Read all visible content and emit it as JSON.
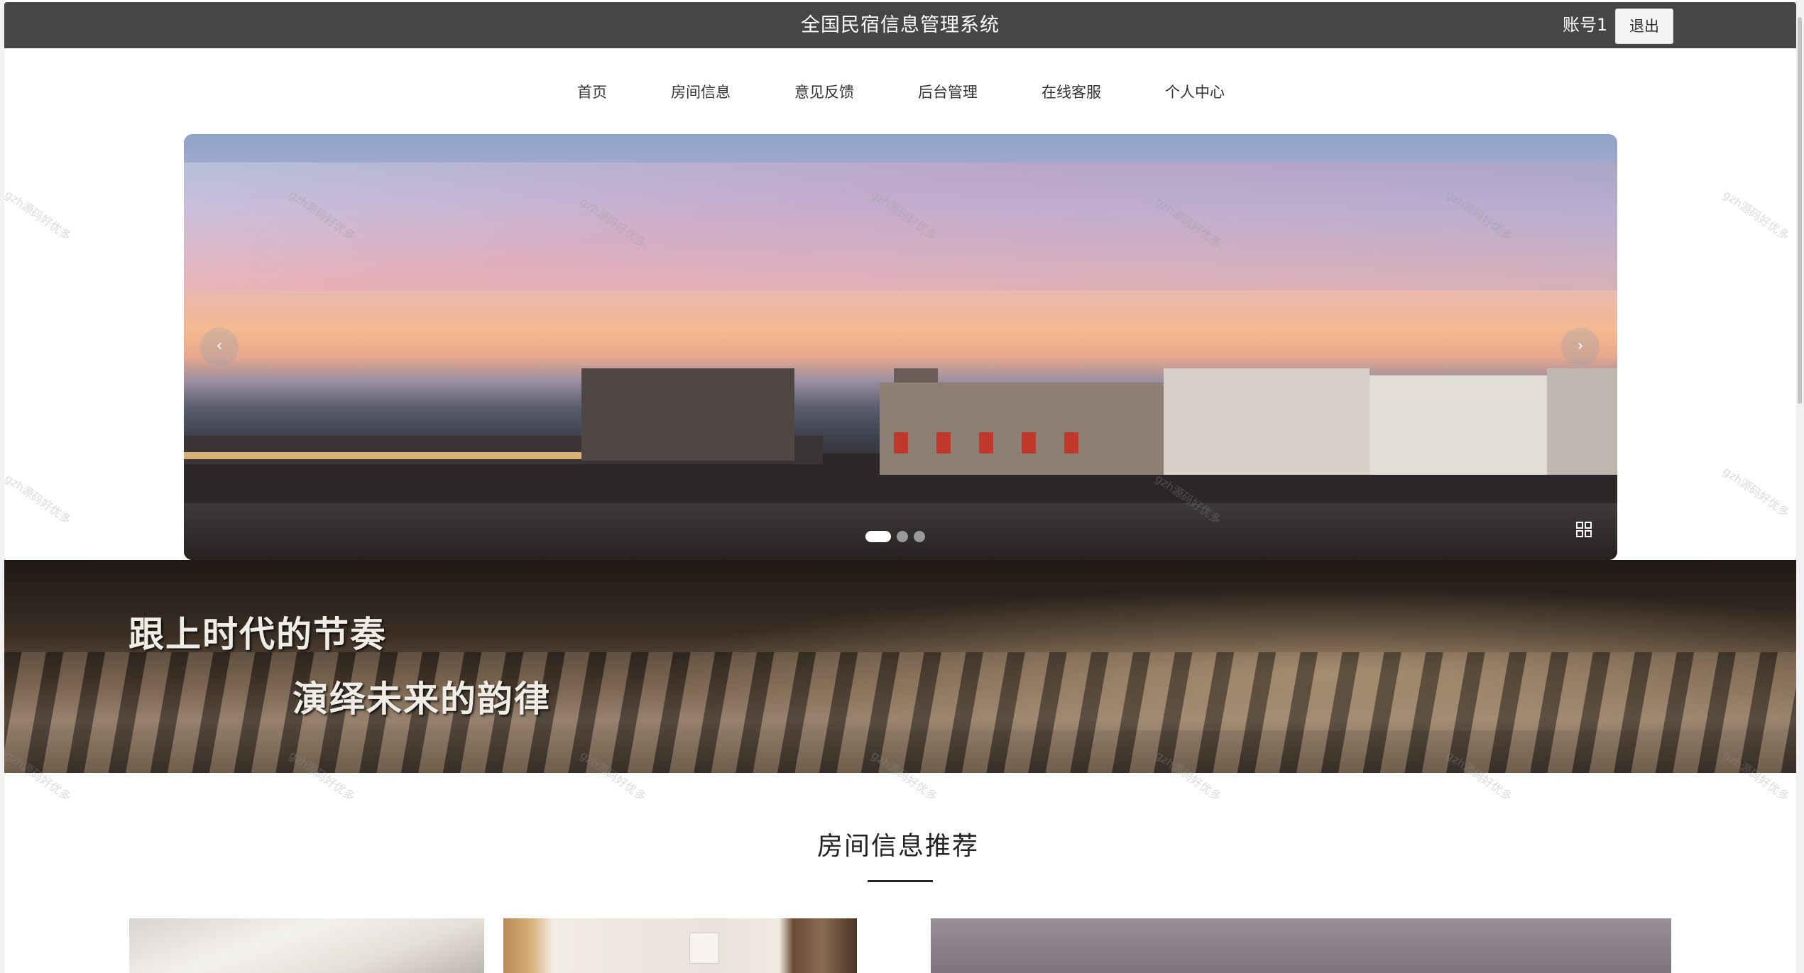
{
  "header": {
    "title": "全国民宿信息管理系统",
    "account": "账号1",
    "logout_label": "退出"
  },
  "nav": {
    "items": [
      {
        "label": "首页"
      },
      {
        "label": "房间信息"
      },
      {
        "label": "意见反馈"
      },
      {
        "label": "后台管理"
      },
      {
        "label": "在线客服"
      },
      {
        "label": "个人中心"
      }
    ],
    "active_index": 0
  },
  "carousel": {
    "prev_icon": "chevron-left-icon",
    "next_icon": "chevron-right-icon",
    "prev_glyph": "‹",
    "next_glyph": "›",
    "slide_count": 3,
    "active_slide": 0
  },
  "banner": {
    "line1": "跟上时代的节奏",
    "line2": "演绎未来的韵律"
  },
  "section": {
    "title": "房间信息推荐"
  },
  "watermark": "gzh源码好优多",
  "colors": {
    "header_bg": "#464646",
    "header_text": "#ffffff",
    "accent": "#000000"
  }
}
